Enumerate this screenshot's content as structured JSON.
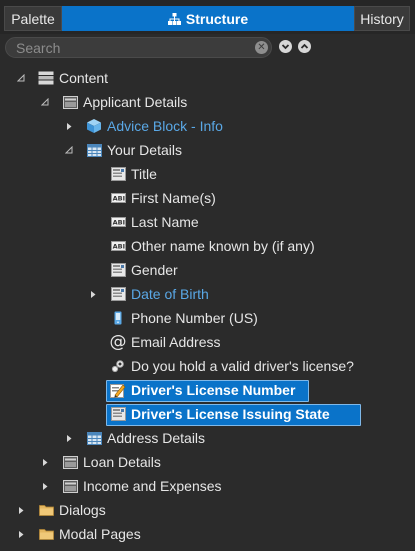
{
  "tabs": [
    {
      "label": "Palette"
    },
    {
      "label": "Structure"
    },
    {
      "label": "History"
    }
  ],
  "search": {
    "placeholder": "Search",
    "value": ""
  },
  "tree": [
    {
      "label": "Content",
      "icon": "form-icon",
      "twisty": "expanded",
      "level": 0
    },
    {
      "label": "Applicant Details",
      "icon": "section-icon",
      "twisty": "expanded",
      "level": 1
    },
    {
      "label": "Advice Block - Info",
      "icon": "block-icon",
      "twisty": "collapsed",
      "level": 2,
      "style": "link"
    },
    {
      "label": "Your Details",
      "icon": "table-icon",
      "twisty": "expanded",
      "level": 2
    },
    {
      "label": "Title",
      "icon": "dropdown-icon",
      "level": 3
    },
    {
      "label": "First Name(s)",
      "icon": "textfield-icon",
      "level": 3
    },
    {
      "label": "Last Name",
      "icon": "textfield-icon",
      "level": 3
    },
    {
      "label": "Other name known by (if any)",
      "icon": "textfield-icon",
      "level": 3
    },
    {
      "label": "Gender",
      "icon": "dropdown-icon",
      "level": 3
    },
    {
      "label": "Date of Birth",
      "icon": "dropdown-icon",
      "twisty": "collapsed",
      "level": 3,
      "style": "link"
    },
    {
      "label": "Phone Number (US)",
      "icon": "phone-icon",
      "level": 3
    },
    {
      "label": "Email Address",
      "icon": "at-icon",
      "level": 3
    },
    {
      "label": "Do you hold a valid driver's license?",
      "icon": "radio-icon",
      "level": 3
    },
    {
      "label": "Driver's License Number",
      "icon": "edit-field-icon",
      "level": 3,
      "style": "selected"
    },
    {
      "label": "Driver's License Issuing State",
      "icon": "dropdown-icon",
      "level": 3,
      "style": "selected"
    },
    {
      "label": "Address Details",
      "icon": "table-icon",
      "twisty": "collapsed",
      "level": 2
    },
    {
      "label": "Loan Details",
      "icon": "section-icon",
      "twisty": "collapsed",
      "level": 1
    },
    {
      "label": "Income and Expenses",
      "icon": "section-icon",
      "twisty": "collapsed",
      "level": 1
    },
    {
      "label": "Dialogs",
      "icon": "folder-icon",
      "twisty": "collapsed",
      "level": 0
    },
    {
      "label": "Modal Pages",
      "icon": "folder-icon",
      "twisty": "collapsed",
      "level": 0
    }
  ],
  "colors": {
    "accent": "#0a73c9",
    "link": "#5aa8e6",
    "background": "#2b2b2b"
  }
}
